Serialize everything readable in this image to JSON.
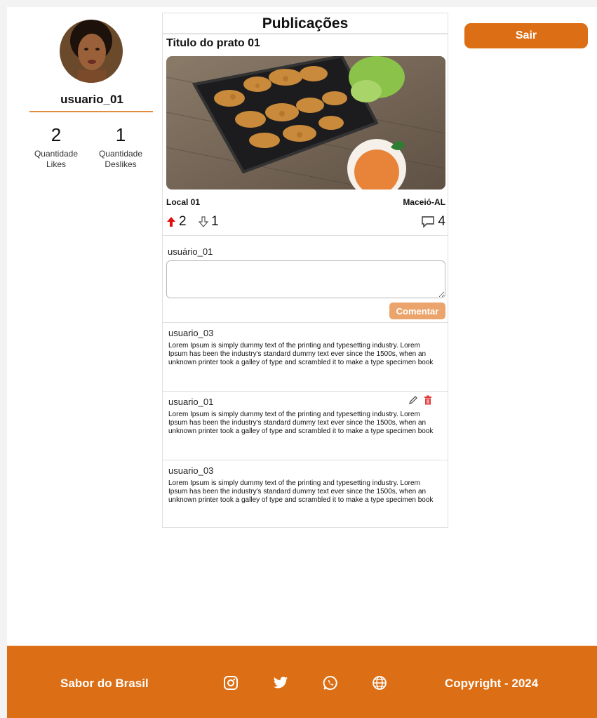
{
  "profile": {
    "username": "usuario_01",
    "likes_count": "2",
    "likes_label_1": "Quantidade",
    "likes_label_2": "Likes",
    "dislikes_count": "1",
    "dislikes_label_1": "Quantidade",
    "dislikes_label_2": "Deslikes"
  },
  "feed": {
    "title": "Publicações",
    "post": {
      "title": "Titulo do prato 01",
      "local": "Local 01",
      "city": "Maceió-AL",
      "upvotes": "2",
      "downvotes": "1",
      "comments": "4"
    },
    "composer": {
      "user": "usuário_01",
      "placeholder": "",
      "button": "Comentar"
    },
    "comment_list": [
      {
        "user": "usuario_03",
        "text": "Lorem Ipsum is simply dummy text of the printing and typesetting industry. Lorem Ipsum has been the industry's standard dummy text ever since the 1500s, when an unknown printer took a galley of type and scrambled it to make a type specimen book"
      },
      {
        "user": "usuario_01",
        "text": "Lorem Ipsum is simply dummy text of the printing and typesetting industry. Lorem Ipsum has been the industry's standard dummy text ever since the 1500s, when an unknown printer took a galley of type and scrambled it to make a type specimen book"
      },
      {
        "user": "usuario_03",
        "text": "Lorem Ipsum is simply dummy text of the printing and typesetting industry. Lorem Ipsum has been the industry's standard dummy text ever since the 1500s, when an unknown printer took a galley of type and scrambled it to make a type specimen book"
      }
    ]
  },
  "header": {
    "logout": "Sair"
  },
  "footer": {
    "brand": "Sabor do Brasil",
    "copyright": "Copyright - 2024",
    "icons": [
      "instagram-icon",
      "twitter-icon",
      "whatsapp-icon",
      "globe-icon"
    ]
  },
  "colors": {
    "accent": "#dc6f15",
    "accent_light": "#eba56c",
    "upvote": "#e01010",
    "delete": "#e23b3b"
  }
}
